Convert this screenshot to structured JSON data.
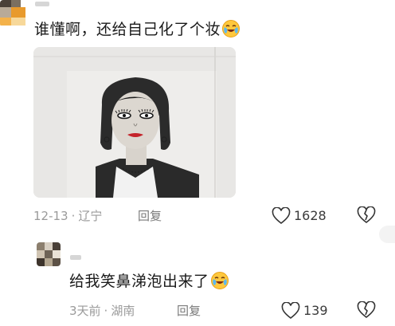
{
  "comments": [
    {
      "text": "谁懂啊，还给自己化了个妆",
      "emoji": "crying-laughing-emoji",
      "date": "12-13",
      "separator": "·",
      "location": "辽宁",
      "reply_label": "回复",
      "likes": "1628",
      "has_photo": true
    },
    {
      "text": "给我笑鼻涕泡出来了",
      "emoji": "crying-laughing-emoji",
      "date": "3天前",
      "separator": "·",
      "location": "湖南",
      "reply_label": "回复",
      "likes": "139",
      "has_photo": false
    }
  ],
  "colors": {
    "meta_text": "#9a9a9a",
    "body_text": "#1a1a1a",
    "photo_bg": "#e9e8e6",
    "lipstick": "#c4232a",
    "avatar_orange": "#f0a030"
  }
}
